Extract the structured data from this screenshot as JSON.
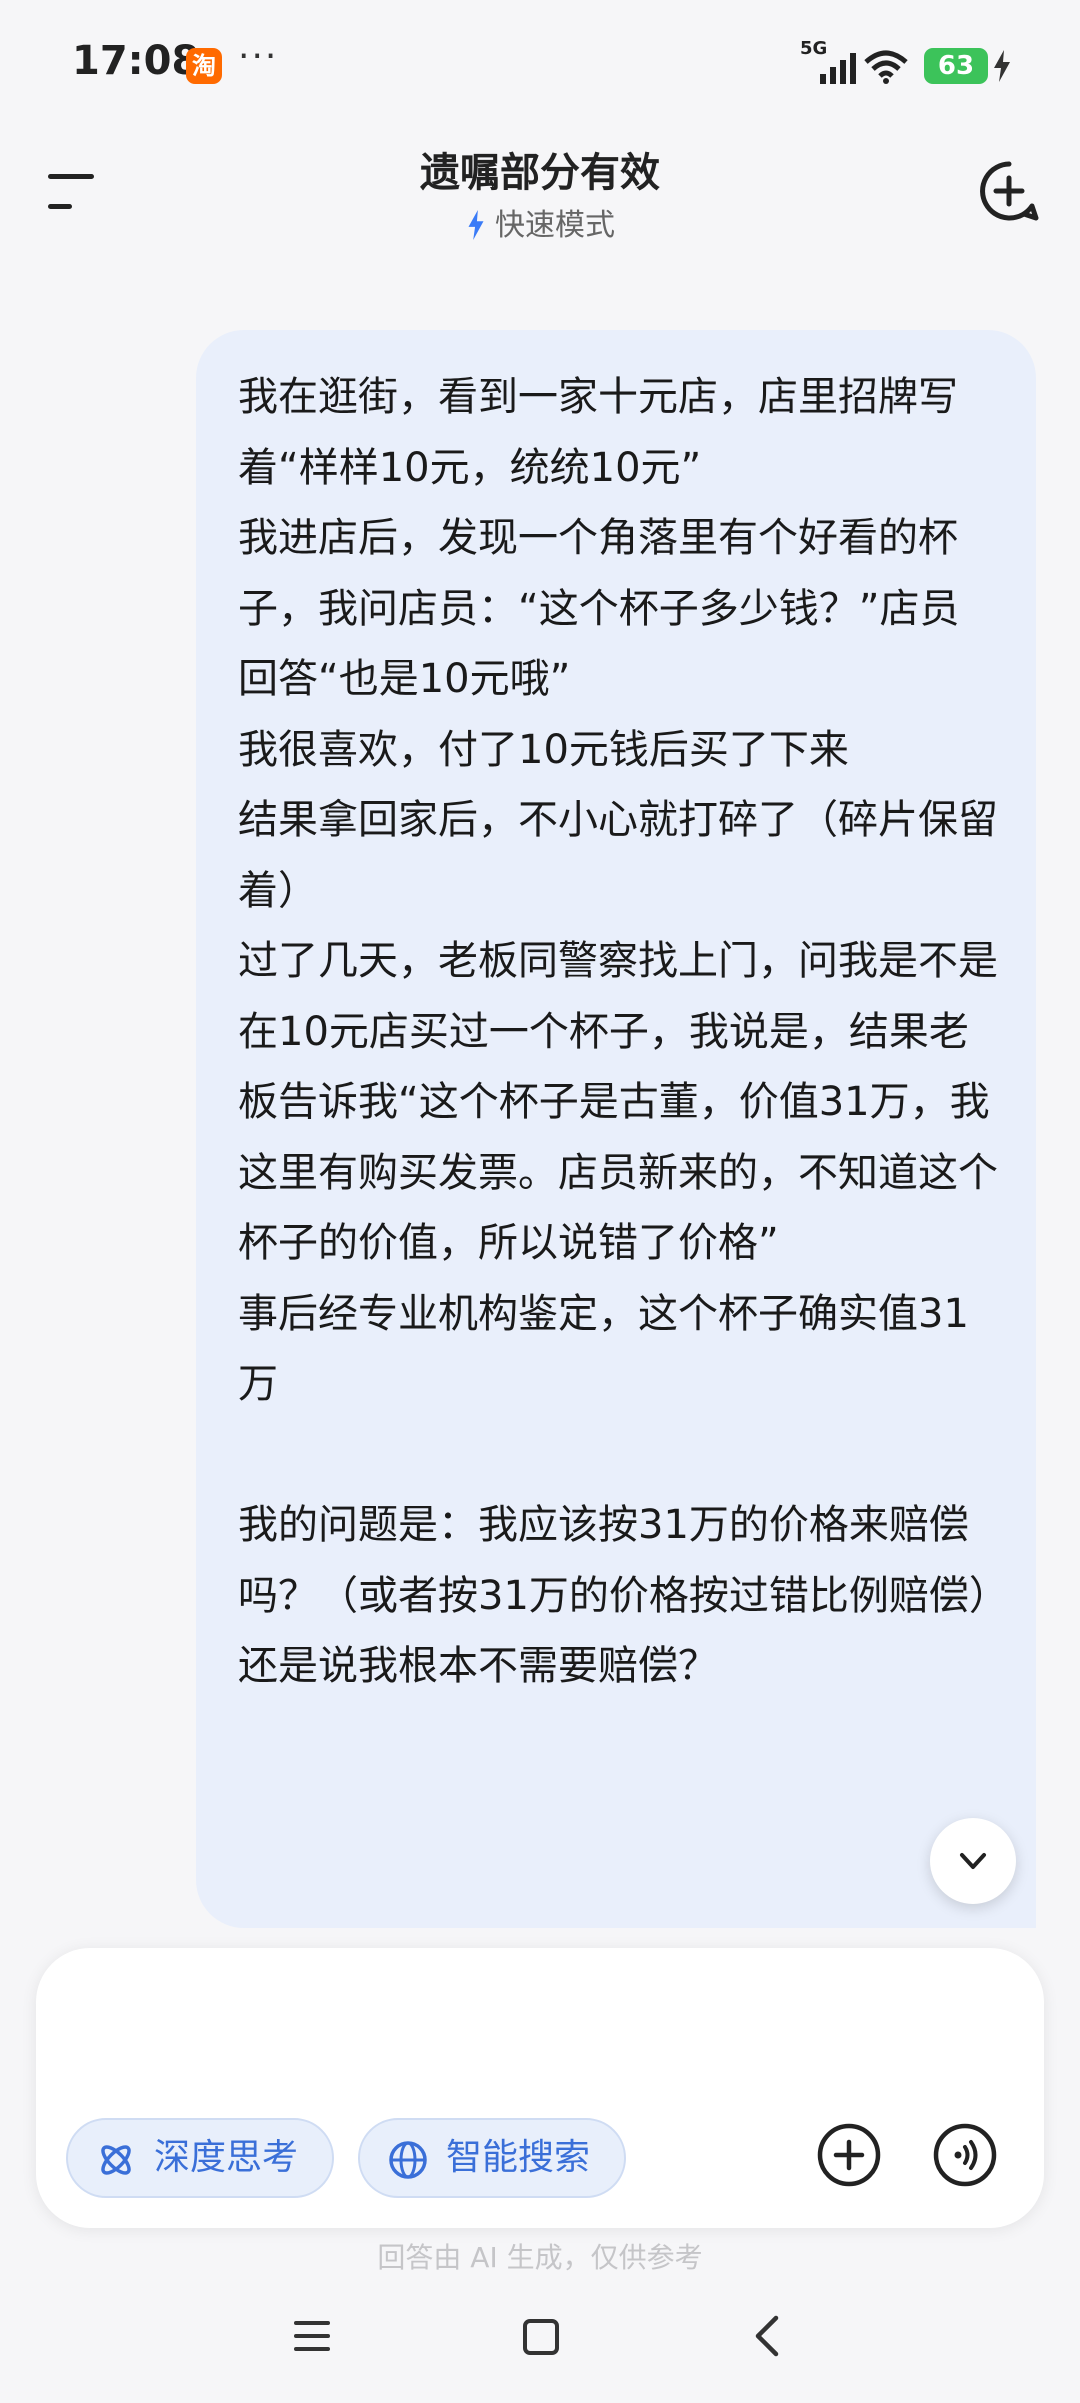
{
  "status_bar": {
    "time": "17:08",
    "app_badge": "淘",
    "more": "···",
    "network": "5G",
    "battery": "63"
  },
  "header": {
    "title": "遗嘱部分有效",
    "mode_label": "快速模式"
  },
  "message": {
    "text": "我在逛街，看到一家十元店，店里招牌写着“样样10元，统统10元”\n我进店后，发现一个角落里有个好看的杯子，我问店员：“这个杯子多少钱？”店员回答“也是10元哦”\n我很喜欢，付了10元钱后买了下来\n结果拿回家后，不小心就打碎了（碎片保留着）\n过了几天，老板同警察找上门，问我是不是在10元店买过一个杯子，我说是，结果老板告诉我“这个杯子是古董，价值31万，我这里有购买发票。店员新来的，不知道这个杯子的价值，所以说错了价格”\n事后经专业机构鉴定，这个杯子确实值31万\n\n我的问题是：我应该按31万的价格来赔偿吗？（或者按31万的价格按过错比例赔偿）还是说我根本不需要赔偿？"
  },
  "input": {
    "deep_think_label": "深度思考",
    "smart_search_label": "智能搜索"
  },
  "disclaimer": "回答由 AI 生成，仅供参考",
  "icons": [
    "menu-icon",
    "new-chat-icon",
    "chevron-down-icon",
    "atom-icon",
    "globe-icon",
    "plus-icon",
    "voice-icon",
    "nav-menu-icon",
    "nav-home-icon",
    "nav-back-icon"
  ],
  "colors": {
    "accent": "#3a7bf7",
    "bubble": "#e9effb",
    "battery": "#3cc35a"
  }
}
